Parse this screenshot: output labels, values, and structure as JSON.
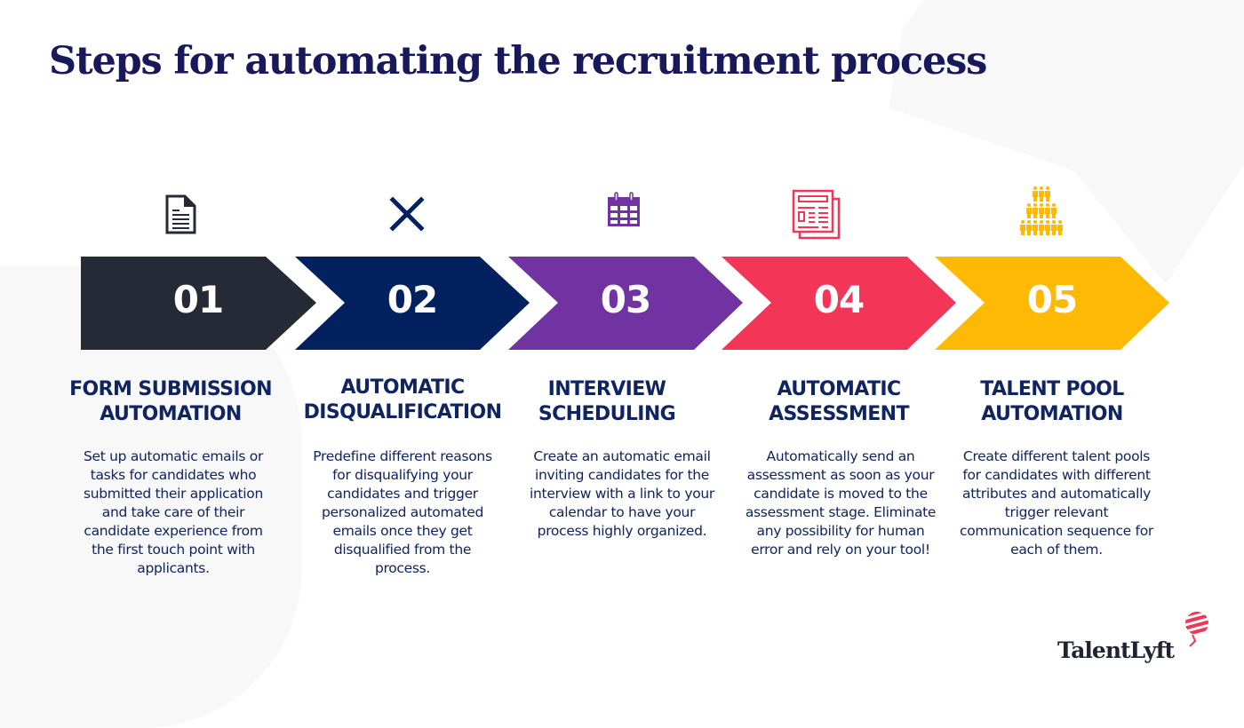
{
  "title": "Steps for automating the recruitment process",
  "steps": [
    {
      "number": "01",
      "icon": "document-icon",
      "color": "#262a36",
      "heading_line1": "FORM SUBMISSION",
      "heading_line2": "AUTOMATION",
      "description": "Set up automatic emails or tasks for candidates who submitted their application and take care of their candidate experience from the first touch point with applicants."
    },
    {
      "number": "02",
      "icon": "close-x-icon",
      "color": "#03215f",
      "heading_line1": "AUTOMATIC",
      "heading_line2": "DISQUALIFICATION",
      "description": "Predefine different reasons for disqualifying your candidates and trigger personalized automated emails once they get disqualified from the process."
    },
    {
      "number": "03",
      "icon": "calendar-icon",
      "color": "#7033a1",
      "heading_line1": "INTERVIEW",
      "heading_line2": "SCHEDULING",
      "description": "Create an automatic email inviting candidates for the interview with a link to your calendar to have your process highly organized."
    },
    {
      "number": "04",
      "icon": "newspaper-icon",
      "color": "#f33558",
      "heading_line1": "AUTOMATIC",
      "heading_line2": "ASSESSMENT",
      "description": "Automatically send an assessment as soon as your candidate is moved to the assessment stage. Eliminate any possibility for human error and rely on your tool!"
    },
    {
      "number": "05",
      "icon": "people-pyramid-icon",
      "color": "#fdb903",
      "heading_line1": "TALENT POOL",
      "heading_line2": "AUTOMATION",
      "description": "Create different talent pools for candidates with different attributes and automatically trigger relevant communication sequence for each of them."
    }
  ],
  "brand": {
    "name": "TalentLyft",
    "accent": "#f33558"
  }
}
